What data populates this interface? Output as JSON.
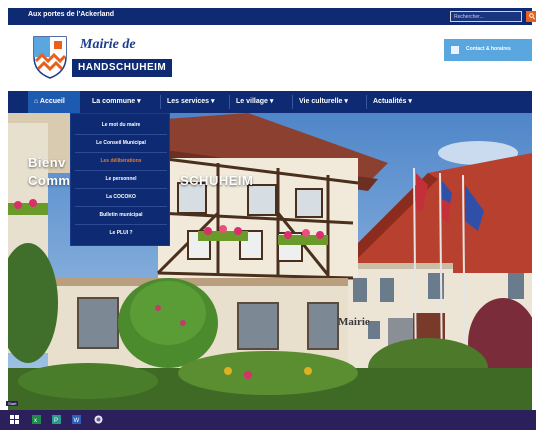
{
  "topbar": {
    "tagline": "Aux portes de l'Ackerland",
    "search_placeholder": "Rechercher..."
  },
  "header": {
    "logo_title": "Mairie de",
    "logo_name": "HANDSCHUHEIM",
    "contact_label": "Contact & horaires"
  },
  "nav": {
    "items": [
      {
        "label": "Accueil"
      },
      {
        "label": "La commune ▾"
      },
      {
        "label": "Les services ▾"
      },
      {
        "label": "Le village ▾"
      },
      {
        "label": "Vie culturelle ▾"
      },
      {
        "label": "Actualités ▾"
      }
    ]
  },
  "hero": {
    "text_line1": "Bienv",
    "text_line2": "Comm",
    "text_line3": "SCHUHEIM",
    "sign": "Mairie"
  },
  "dropdown": {
    "items": [
      {
        "label": "Le mot du maire"
      },
      {
        "label": "Le Conseil Municipal"
      },
      {
        "label": "Les délibérations"
      },
      {
        "label": "Le personnel"
      },
      {
        "label": "La COCOKO"
      },
      {
        "label": "Bulletin municipal"
      },
      {
        "label": "Le PLUI ?"
      }
    ]
  },
  "taskbar": {
    "corner": "Start"
  },
  "colors": {
    "navy": "#0e2a72",
    "active": "#1e5bb0",
    "accent_orange": "#e9601d",
    "contact_blue": "#5aa6df",
    "taskbar": "#2b1f5c"
  }
}
